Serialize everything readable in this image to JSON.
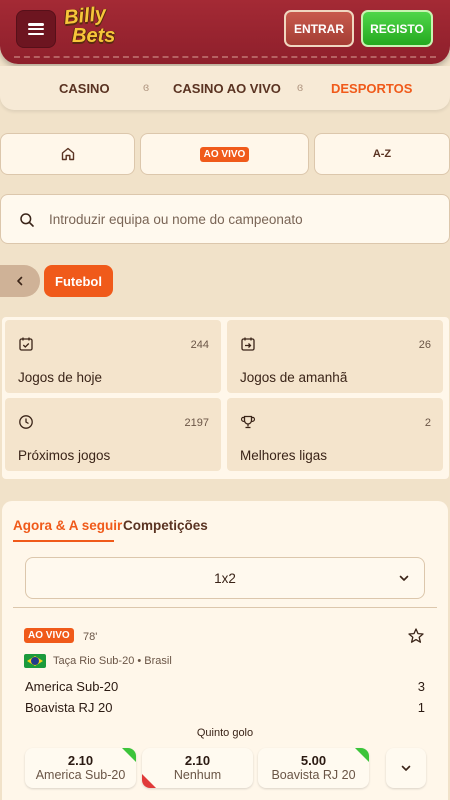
{
  "header": {
    "logo_line1": "Billy",
    "logo_line2": "Bets",
    "login_label": "ENTRAR",
    "register_label": "REGISTO"
  },
  "nav": {
    "items": [
      {
        "label": "CASINO",
        "active": false
      },
      {
        "label": "CASINO AO VIVO",
        "active": false
      },
      {
        "label": "DESPORTOS",
        "active": true
      }
    ]
  },
  "sport_tabs": {
    "live_label": "AO VIVO",
    "az_label": "A-Z"
  },
  "search": {
    "placeholder": "Introduzir equipa ou nome do campeonato"
  },
  "filter": {
    "chip_label": "Futebol"
  },
  "quick_links": [
    {
      "label": "Jogos de hoje",
      "count": "244",
      "icon": "calendar-check-icon"
    },
    {
      "label": "Jogos de amanhã",
      "count": "26",
      "icon": "calendar-arrow-icon"
    },
    {
      "label": "Próximos jogos",
      "count": "2197",
      "icon": "clock-icon"
    },
    {
      "label": "Melhores ligas",
      "count": "2",
      "icon": "trophy-icon"
    }
  ],
  "panel": {
    "tabs": [
      {
        "label": "Agora & A seguir",
        "active": true
      },
      {
        "label": "Competições",
        "active": false
      }
    ],
    "market_select": "1x2"
  },
  "match": {
    "status": "AO VIVO",
    "minute": "78'",
    "competition": "Taça Rio Sub-20 • Brasil",
    "home_team": "America Sub-20",
    "away_team": "Boavista RJ 20",
    "home_score": "3",
    "away_score": "1",
    "market_name": "Quinto golo",
    "odds": [
      {
        "value": "2.10",
        "name": "America Sub-20"
      },
      {
        "value": "2.10",
        "name": "Nenhum"
      },
      {
        "value": "5.00",
        "name": "Boavista RJ 20"
      }
    ]
  },
  "colors": {
    "brand_red": "#9a2430",
    "accent_orange": "#f05a1a",
    "register_green": "#2fbd27",
    "background": "#f1e2c9"
  }
}
